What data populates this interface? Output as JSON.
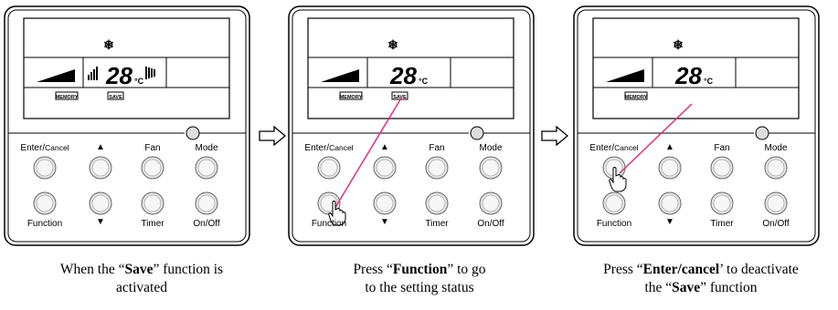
{
  "panels": [
    {
      "lcd": {
        "temp": "28",
        "unit": "°C",
        "memory": "MEMORY",
        "save": "SAVE",
        "show_save": true,
        "show_fan_bars": true
      },
      "buttons": {
        "enter": "Enter/",
        "cancel": "Cancel",
        "up": "▲",
        "fan": "Fan",
        "mode": "Mode",
        "function": "Function",
        "down": "▼",
        "timer": "Timer",
        "onoff": "On/Off"
      },
      "caption": {
        "pre": "When the “",
        "bold": "Save",
        "post": "” function is",
        "line2": "activated"
      }
    },
    {
      "lcd": {
        "temp": "28",
        "unit": "°C",
        "memory": "MEMORY",
        "save": "SAVE",
        "show_save": true,
        "show_fan_bars": false
      },
      "buttons": {
        "enter": "Enter/",
        "cancel": "Cancel",
        "up": "▲",
        "fan": "Fan",
        "mode": "Mode",
        "function": "Function",
        "down": "▼",
        "timer": "Timer",
        "onoff": "On/Off"
      },
      "caption": {
        "pre": "Press “",
        "bold": "Function",
        "post": "” to go",
        "line2": "to the setting status"
      }
    },
    {
      "lcd": {
        "temp": "28",
        "unit": "°C",
        "memory": "MEMORY",
        "save": "",
        "show_save": false,
        "show_fan_bars": false
      },
      "buttons": {
        "enter": "Enter/",
        "cancel": "Cancel",
        "up": "▲",
        "fan": "Fan",
        "mode": "Mode",
        "function": "Function",
        "down": "▼",
        "timer": "Timer",
        "onoff": "On/Off"
      },
      "caption": {
        "pre": "Press “",
        "bold": "Enter/cancel",
        "post": "’ to deactivate",
        "line2_pre": "the “",
        "line2_bold": "Save",
        "line2_post": "” function"
      }
    }
  ],
  "colors": {
    "pointer_line": "#e0307a",
    "button_fill": "#e6e6e6",
    "button_stroke": "#666666"
  }
}
